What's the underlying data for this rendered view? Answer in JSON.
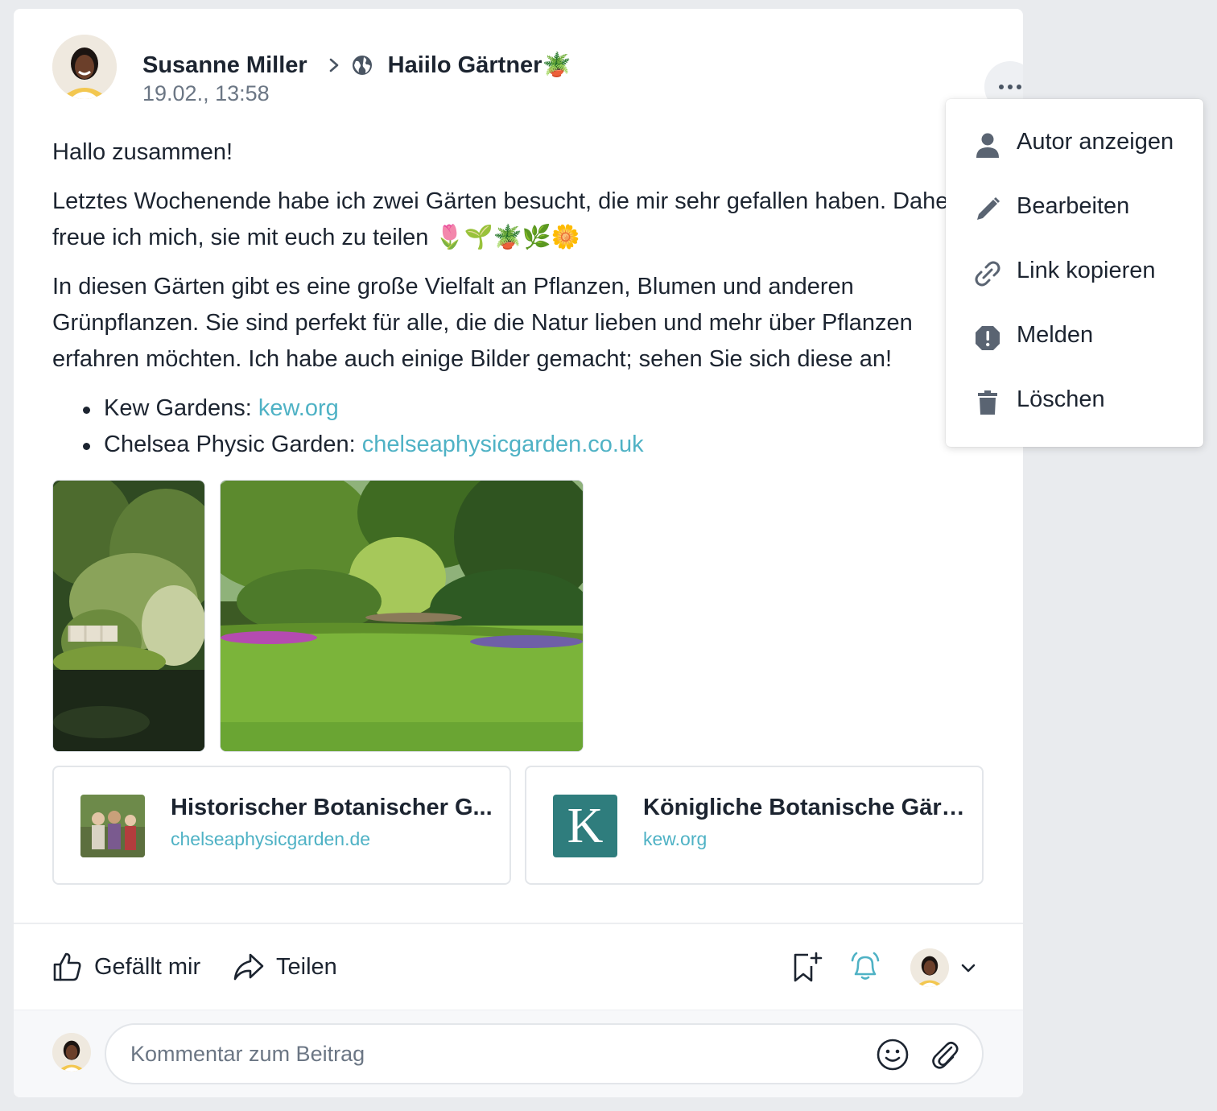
{
  "post": {
    "author": "Susanne Miller",
    "target": "Haiilo Gärtner🪴",
    "timestamp": "19.02., 13:58",
    "greeting": "Hallo zusammen!",
    "paragraph1_line1": "Letztes Wochenende habe ich zwei Gärten besucht, die mir sehr gefallen haben. Daher",
    "paragraph1_line2": "freue ich mich, sie mit euch zu teilen 🌷🌱🪴🌿🌼",
    "paragraph2_line1": "In diesen Gärten gibt es eine große Vielfalt an Pflanzen, Blumen und anderen",
    "paragraph2_line2": "Grünpflanzen. Sie sind perfekt für alle, die die Natur lieben und mehr über Pflanzen",
    "paragraph2_line3": "erfahren möchten. Ich habe auch einige Bilder gemacht; sehen Sie sich diese an!",
    "list": [
      {
        "label": "Kew Gardens: ",
        "link": "kew.org"
      },
      {
        "label": "Chelsea Physic Garden: ",
        "link": "chelseaphysicgarden.co.uk"
      }
    ],
    "link_previews": [
      {
        "title": "Historischer Botanischer G...",
        "url": "chelseaphysicgarden.de"
      },
      {
        "title": "Königliche Botanische Gärt...",
        "url": "kew.org",
        "logo_letter": "K"
      }
    ]
  },
  "actions": {
    "like": "Gefällt mir",
    "share": "Teilen"
  },
  "comment": {
    "placeholder": "Kommentar zum Beitrag"
  },
  "menu": {
    "items": [
      {
        "label": "Autor anzeigen",
        "icon": "person-icon"
      },
      {
        "label": "Bearbeiten",
        "icon": "pencil-icon"
      },
      {
        "label": "Link kopieren",
        "icon": "link-icon"
      },
      {
        "label": "Melden",
        "icon": "report-icon"
      },
      {
        "label": "Löschen",
        "icon": "trash-icon"
      }
    ]
  },
  "colors": {
    "accent": "#4fb2c5",
    "text": "#1c2430",
    "muted": "#6b7684",
    "page_bg": "#e9ebee"
  }
}
